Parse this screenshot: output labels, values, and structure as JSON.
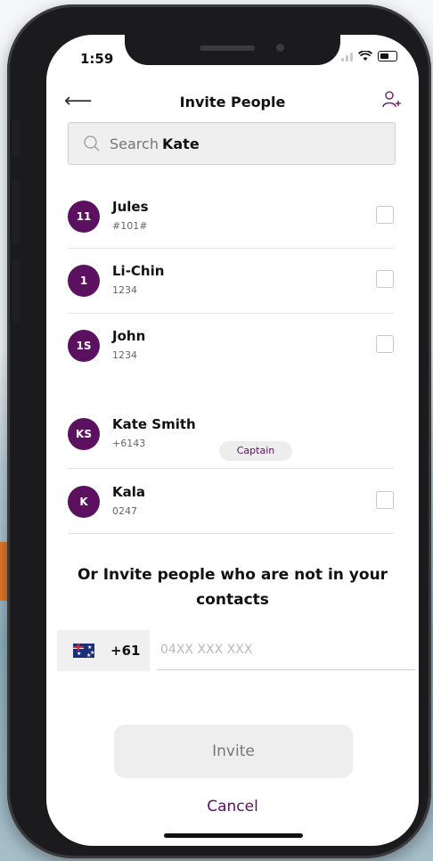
{
  "status_bar": {
    "time": "1:59"
  },
  "header": {
    "title": "Invite People"
  },
  "search": {
    "label": "Search",
    "term": "Kate"
  },
  "contacts": [
    {
      "initials": "11",
      "name": "Jules",
      "sub": "#101#",
      "checked": false
    },
    {
      "initials": "1",
      "name": "Li-Chin",
      "sub": "1234",
      "checked": false
    },
    {
      "initials": "1S",
      "name": "John",
      "sub": "1234",
      "checked": false
    },
    {
      "initials": "KS",
      "name": "Kate Smith",
      "sub": "+6143",
      "badge": "Captain"
    },
    {
      "initials": "K",
      "name": "Kala",
      "sub": "0247",
      "checked": false
    }
  ],
  "invite_section": {
    "heading": "Or Invite people who are not in your contacts",
    "country_code": "+61",
    "phone_placeholder": "04XX XXX XXX",
    "invite_label": "Invite",
    "cancel_label": "Cancel"
  },
  "colors": {
    "accent": "#5c1060",
    "button_bg": "#eeeeee"
  }
}
